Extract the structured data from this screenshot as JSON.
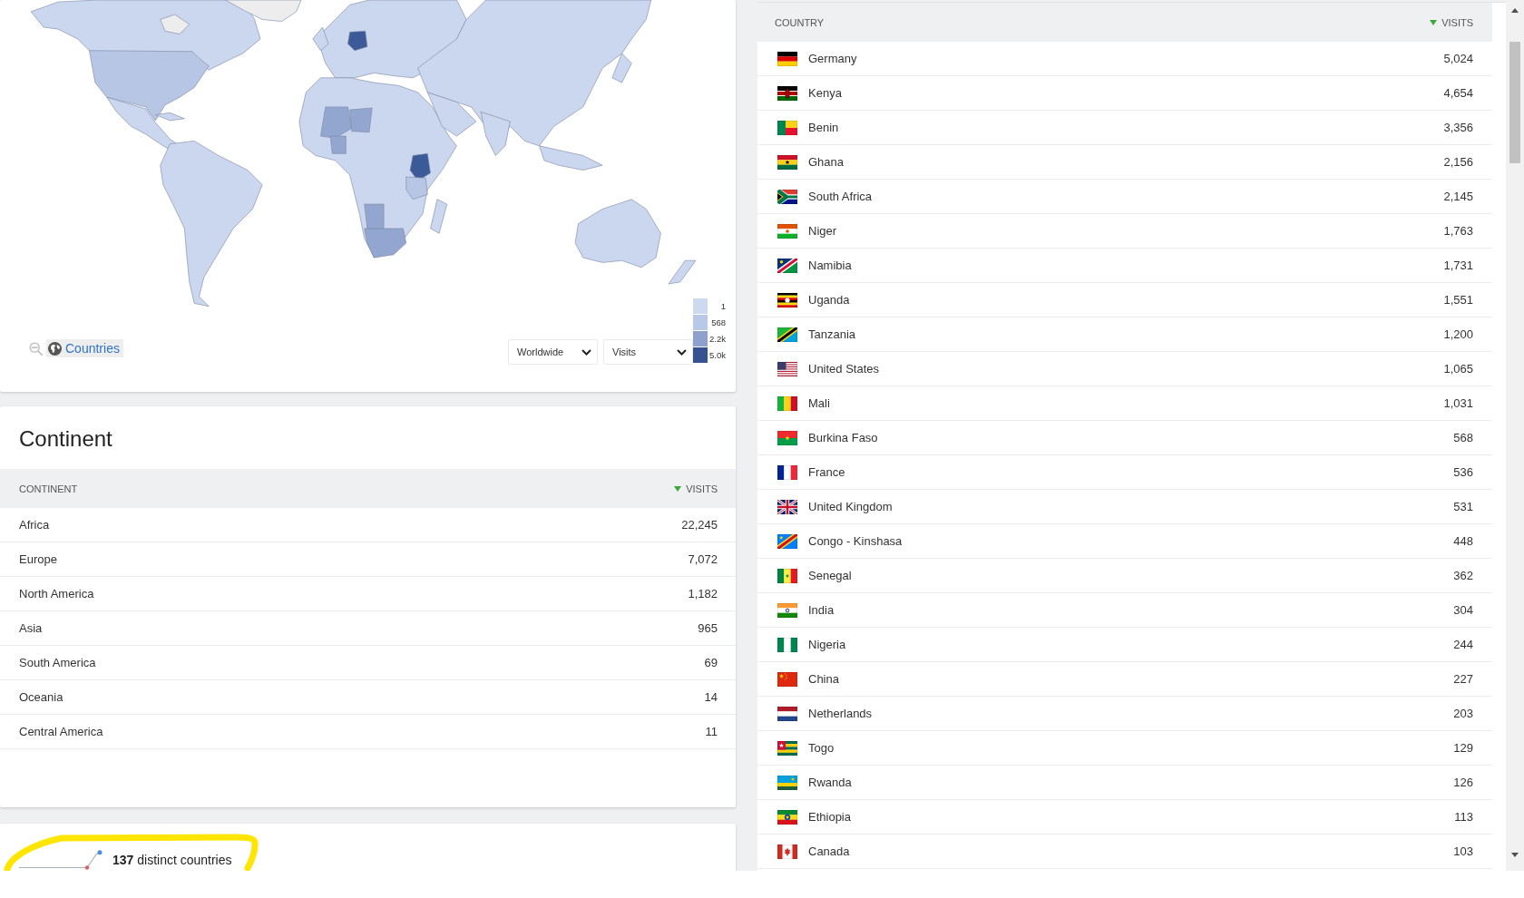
{
  "map": {
    "zoom_out_disabled": true,
    "breadcrumb": "Countries",
    "region_select": "Worldwide",
    "metric_select": "Visits",
    "legend": [
      {
        "label": "1",
        "color": "#cdd9ef"
      },
      {
        "label": "568",
        "color": "#b9c8e6"
      },
      {
        "label": "2.2k",
        "color": "#8ea1cd"
      },
      {
        "label": "5.0k",
        "color": "#36538f"
      }
    ]
  },
  "continent_table": {
    "title": "Continent",
    "columns": [
      {
        "label": "CONTINENT",
        "sorted_descending": false
      },
      {
        "label": "VISITS",
        "sorted_descending": true
      }
    ],
    "rows": [
      {
        "continent": "Africa",
        "visits": "22,245"
      },
      {
        "continent": "Europe",
        "visits": "7,072"
      },
      {
        "continent": "North America",
        "visits": "1,182"
      },
      {
        "continent": "Asia",
        "visits": "965"
      },
      {
        "continent": "South America",
        "visits": "69"
      },
      {
        "continent": "Oceania",
        "visits": "14"
      },
      {
        "continent": "Central America",
        "visits": "11"
      }
    ]
  },
  "summary": {
    "text": "**137** distinct countries",
    "highlighted": true
  },
  "country_table": {
    "columns": [
      {
        "label": "COUNTRY",
        "sorted_descending": false
      },
      {
        "label": "VISITS",
        "sorted_descending": true
      }
    ],
    "rows": [
      {
        "country": "Germany",
        "visits": "5,024"
      },
      {
        "country": "Kenya",
        "visits": "4,654"
      },
      {
        "country": "Benin",
        "visits": "3,356"
      },
      {
        "country": "Ghana",
        "visits": "2,156"
      },
      {
        "country": "South Africa",
        "visits": "2,145"
      },
      {
        "country": "Niger",
        "visits": "1,763"
      },
      {
        "country": "Namibia",
        "visits": "1,731"
      },
      {
        "country": "Uganda",
        "visits": "1,551"
      },
      {
        "country": "Tanzania",
        "visits": "1,200"
      },
      {
        "country": "United States",
        "visits": "1,065"
      },
      {
        "country": "Mali",
        "visits": "1,031"
      },
      {
        "country": "Burkina Faso",
        "visits": "568"
      },
      {
        "country": "France",
        "visits": "536"
      },
      {
        "country": "United Kingdom",
        "visits": "531"
      },
      {
        "country": "Congo - Kinshasa",
        "visits": "448"
      },
      {
        "country": "Senegal",
        "visits": "362"
      },
      {
        "country": "India",
        "visits": "304"
      },
      {
        "country": "Nigeria",
        "visits": "244"
      },
      {
        "country": "China",
        "visits": "227"
      },
      {
        "country": "Netherlands",
        "visits": "203"
      },
      {
        "country": "Togo",
        "visits": "129"
      },
      {
        "country": "Rwanda",
        "visits": "126"
      },
      {
        "country": "Ethiopia",
        "visits": "113"
      },
      {
        "country": "Canada",
        "visits": "103"
      }
    ]
  }
}
